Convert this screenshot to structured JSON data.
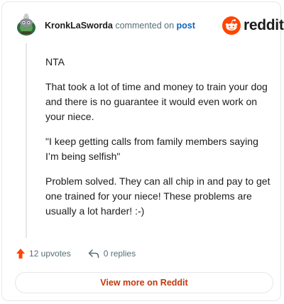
{
  "comment": {
    "author": "KronkLaSworda",
    "action_text": "commented on",
    "post_link_text": "post",
    "paragraphs": [
      "NTA",
      "That took a lot of time and money to train your dog and there is no guarantee it would even work on your niece.",
      "\"I keep getting calls from family members saying I’m being selfish\"",
      "Problem solved. They can all chip in and pay to get one trained for your niece! These problems are usually a lot harder! :-)"
    ]
  },
  "brand": {
    "wordmark": "reddit",
    "color": "#ff4500"
  },
  "footer": {
    "upvotes_label": "12 upvotes",
    "replies_label": "0 replies"
  },
  "cta": {
    "label": "View more on Reddit",
    "color": "#c0380d"
  }
}
